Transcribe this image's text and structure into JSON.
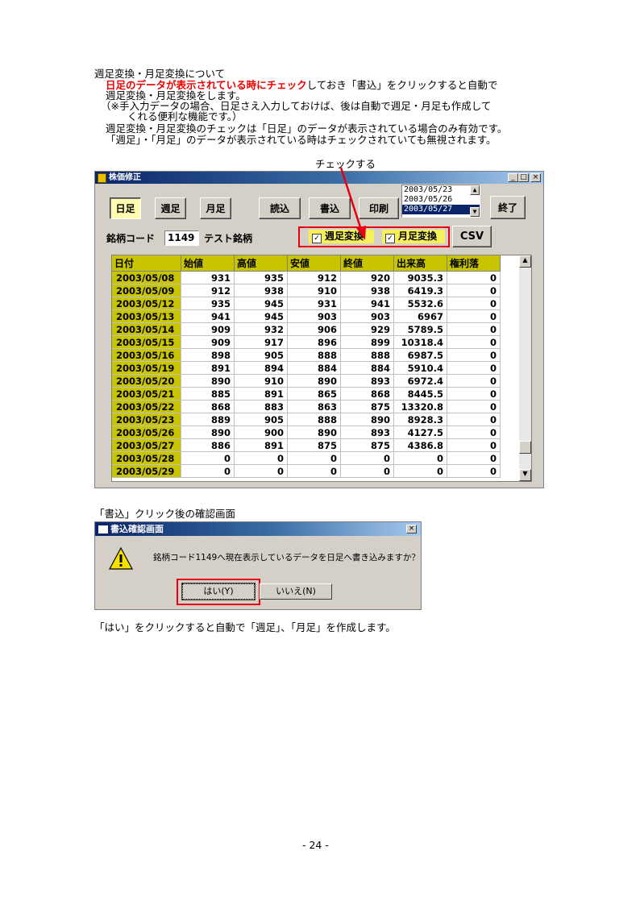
{
  "doc": {
    "heading": "週足変換・月足変換について",
    "line1_red": "日足のデータが表示されている時にチェック",
    "line1_rest": "しておき「書込」をクリックすると自動で",
    "line2": "週足変換・月足変換をします。",
    "line3": "（※手入力データの場合、日足さえ入力しておけば、後は自動で週足・月足も作成して",
    "line4": "くれる便利な機能です。）",
    "line5": "週足変換・月足変換のチェックは「日足」のデータが表示されている場合のみ有効です。",
    "line6": "「週足」・「月足」のデータが表示されている時はチェックされていても無視されます。",
    "annotation": "チェックする",
    "caption_dialog": "「書込」クリック後の確認画面",
    "caption_bottom": "「はい」をクリックすると自動で「週足」、「月足」を作成します。",
    "page_number": "- 24 -"
  },
  "window": {
    "title": "株価修正",
    "buttons": {
      "daily": "日足",
      "weekly": "週足",
      "monthly": "月足",
      "read": "読込",
      "write": "書込",
      "print": "印刷",
      "exit": "終了",
      "csv": "CSV"
    },
    "dates": [
      "2003/05/23",
      "2003/05/26",
      "2003/05/27"
    ],
    "selected_date_index": 2,
    "code_label": "銘柄コード",
    "code_value": "1149",
    "name_value": "テスト銘柄",
    "check_weekly": "週足変換",
    "check_monthly": "月足変換",
    "columns": [
      "日付",
      "始値",
      "高値",
      "安値",
      "終値",
      "出来高",
      "権利落"
    ],
    "rows": [
      [
        "2003/05/08",
        "931",
        "935",
        "912",
        "920",
        "9035.3",
        "0"
      ],
      [
        "2003/05/09",
        "912",
        "938",
        "910",
        "938",
        "6419.3",
        "0"
      ],
      [
        "2003/05/12",
        "935",
        "945",
        "931",
        "941",
        "5532.6",
        "0"
      ],
      [
        "2003/05/13",
        "941",
        "945",
        "903",
        "903",
        "6967",
        "0"
      ],
      [
        "2003/05/14",
        "909",
        "932",
        "906",
        "929",
        "5789.5",
        "0"
      ],
      [
        "2003/05/15",
        "909",
        "917",
        "896",
        "899",
        "10318.4",
        "0"
      ],
      [
        "2003/05/16",
        "898",
        "905",
        "888",
        "888",
        "6987.5",
        "0"
      ],
      [
        "2003/05/19",
        "891",
        "894",
        "884",
        "884",
        "5910.4",
        "0"
      ],
      [
        "2003/05/20",
        "890",
        "910",
        "890",
        "893",
        "6972.4",
        "0"
      ],
      [
        "2003/05/21",
        "885",
        "891",
        "865",
        "868",
        "8445.5",
        "0"
      ],
      [
        "2003/05/22",
        "868",
        "883",
        "863",
        "875",
        "13320.8",
        "0"
      ],
      [
        "2003/05/23",
        "889",
        "905",
        "888",
        "890",
        "8928.3",
        "0"
      ],
      [
        "2003/05/26",
        "890",
        "900",
        "890",
        "893",
        "4127.5",
        "0"
      ],
      [
        "2003/05/27",
        "886",
        "891",
        "875",
        "875",
        "4386.8",
        "0"
      ],
      [
        "2003/05/28",
        "0",
        "0",
        "0",
        "0",
        "0",
        "0"
      ],
      [
        "2003/05/29",
        "0",
        "0",
        "0",
        "0",
        "0",
        "0"
      ]
    ]
  },
  "dialog": {
    "title": "書込確認画面",
    "message": "銘柄コード1149へ現在表示しているデータを日足へ書き込みますか？",
    "yes": "はい(Y)",
    "no": "いいえ(N)",
    "close": "×"
  },
  "colors": {
    "highlight_red": "#e60012",
    "grid_yellow": "#c8c400",
    "check_yellow": "#f6f05c",
    "titlebar": "#0a246a"
  }
}
